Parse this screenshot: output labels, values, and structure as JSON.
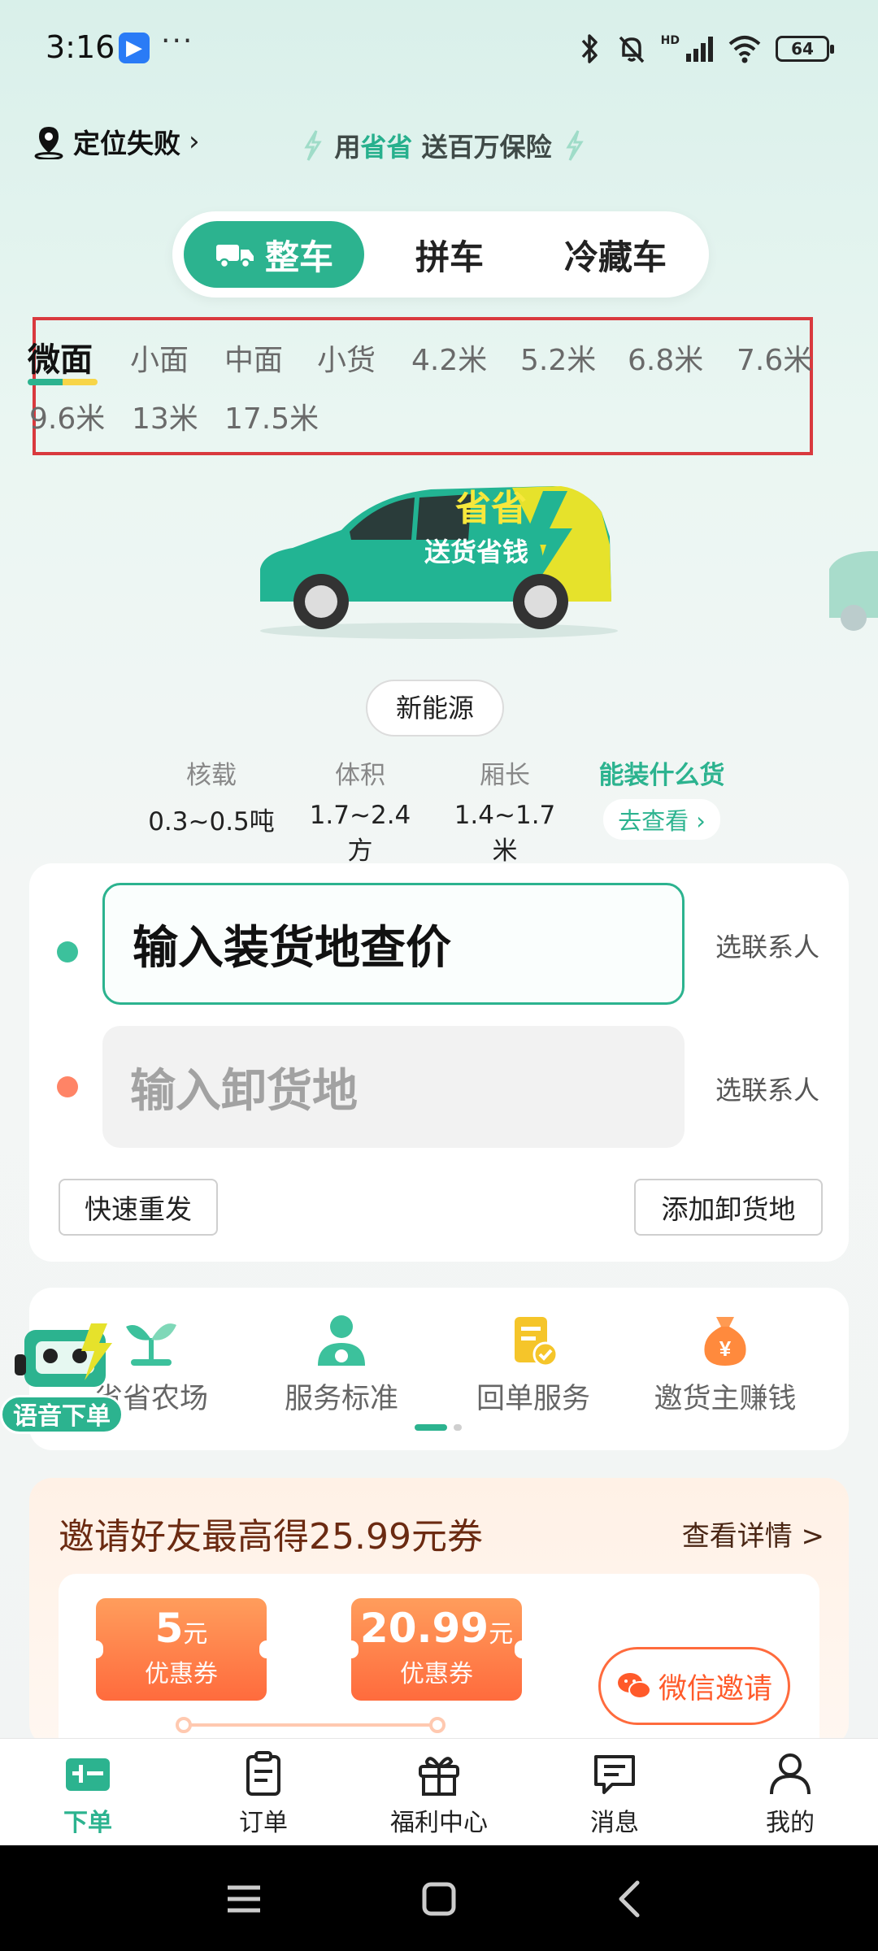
{
  "status_bar": {
    "time": "3:16",
    "more": "···",
    "battery": "64",
    "hd": "HD"
  },
  "location": {
    "text": "定位失败",
    "chevron": "›"
  },
  "promo": {
    "prefix": "用",
    "highlight": "省省",
    "suffix": " 送百万保险"
  },
  "tabs": [
    {
      "label": "整车",
      "active": true
    },
    {
      "label": "拼车"
    },
    {
      "label": "冷藏车"
    }
  ],
  "vehicle_types": [
    "微面",
    "小面",
    "中面",
    "小货",
    "4.2米",
    "5.2米",
    "6.8米",
    "7.6米",
    "9.6米",
    "13米",
    "17.5米"
  ],
  "van_branding": {
    "brand": "省省",
    "slogan": "送货省钱"
  },
  "energy_tag": "新能源",
  "specs": [
    {
      "label": "核载",
      "value": "0.3~0.5吨"
    },
    {
      "label": "体积",
      "value": "1.7~2.4方"
    },
    {
      "label": "厢长",
      "value": "1.4~1.7米"
    }
  ],
  "cargo_link": {
    "label": "能装什么货",
    "button": "去查看 ›"
  },
  "address": {
    "load_placeholder": "输入装货地查价",
    "unload_placeholder": "输入卸货地",
    "contact": "选联系人",
    "quick_resend": "快速重发",
    "add_unload": "添加卸货地"
  },
  "services": [
    {
      "label": "省省农场",
      "icon": "sprout-icon"
    },
    {
      "label": "服务标准",
      "icon": "driver-icon"
    },
    {
      "label": "回单服务",
      "icon": "receipt-check-icon"
    },
    {
      "label": "邀货主赚钱",
      "icon": "money-bag-icon"
    }
  ],
  "voice_order": "语音下单",
  "invite": {
    "title": "邀请好友最高得25.99元券",
    "detail": "查看详情 >",
    "coupons": [
      {
        "amount": "5",
        "unit": "元",
        "label": "优惠券"
      },
      {
        "amount": "20.99",
        "unit": "元",
        "label": "优惠券"
      }
    ],
    "wechat_button": "微信邀请"
  },
  "bottom_nav": [
    {
      "label": "下单",
      "icon": "order-place-icon",
      "active": true
    },
    {
      "label": "订单",
      "icon": "clipboard-icon"
    },
    {
      "label": "福利中心",
      "icon": "gift-icon"
    },
    {
      "label": "消息",
      "icon": "message-icon"
    },
    {
      "label": "我的",
      "icon": "person-icon"
    }
  ],
  "colors": {
    "brand": "#2cb38f",
    "accent_orange": "#ff6b3d",
    "highlight_box": "#d9393e"
  }
}
